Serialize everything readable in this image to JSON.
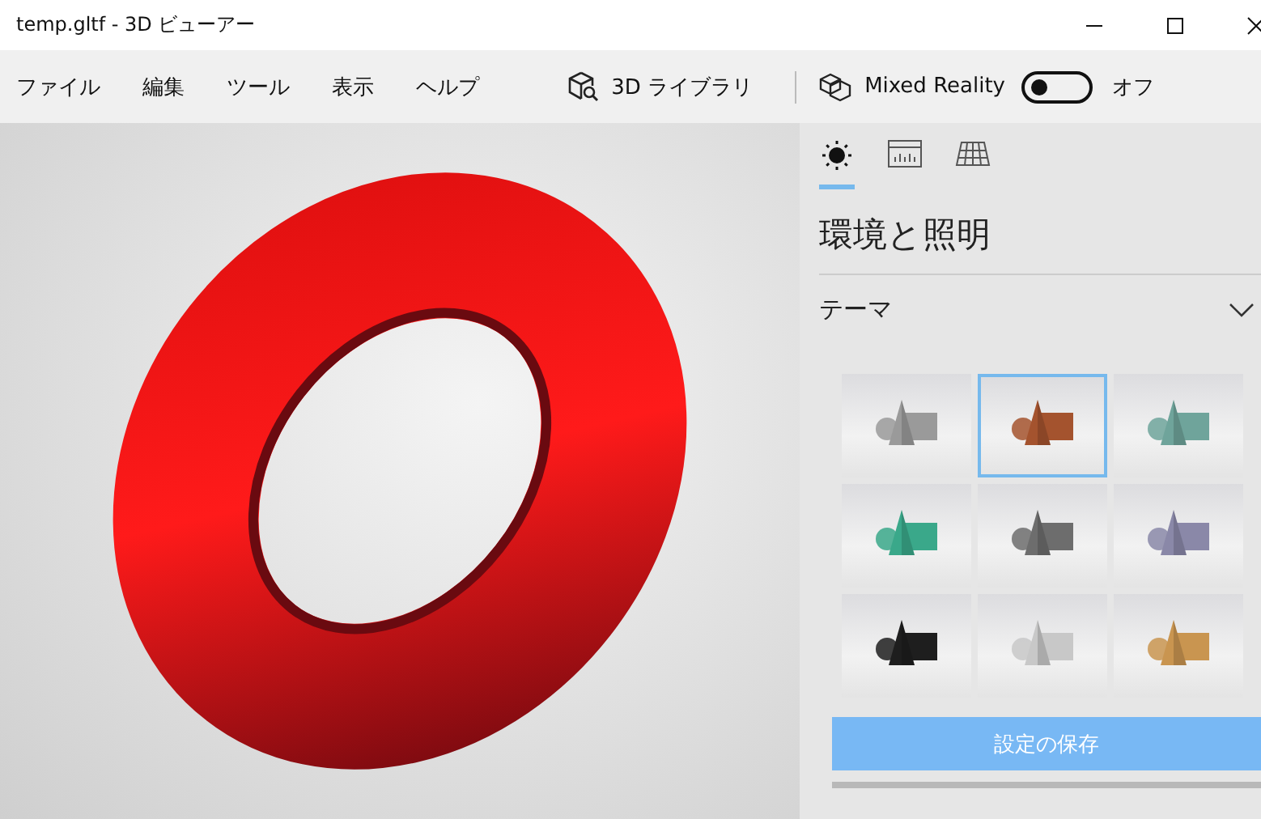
{
  "window": {
    "title": "temp.gltf - 3D ビューアー"
  },
  "menu": [
    "ファイル",
    "編集",
    "ツール",
    "表示",
    "ヘルプ"
  ],
  "library": {
    "label": "3D ライブラリ"
  },
  "mixed_reality": {
    "label": "Mixed Reality",
    "on": false,
    "state_text": "オフ"
  },
  "panel_tabs": [
    {
      "kind": "light",
      "selected": true
    },
    {
      "kind": "stats",
      "selected": false
    },
    {
      "kind": "grid",
      "selected": false
    }
  ],
  "panel": {
    "title": "環境と照明",
    "section": "テーマ",
    "expanded": true,
    "themes": [
      {
        "color": "#9a9a9a",
        "selected": false
      },
      {
        "color": "#a4532e",
        "selected": true
      },
      {
        "color": "#6fa49b",
        "selected": false
      },
      {
        "color": "#3aa88a",
        "selected": false
      },
      {
        "color": "#6d6d6d",
        "selected": false
      },
      {
        "color": "#8a88a8",
        "selected": false
      },
      {
        "color": "#1e1e1e",
        "selected": false
      },
      {
        "color": "#c8c8c8",
        "selected": false
      },
      {
        "color": "#c99550",
        "selected": false
      }
    ],
    "save_button": "設定の保存"
  }
}
